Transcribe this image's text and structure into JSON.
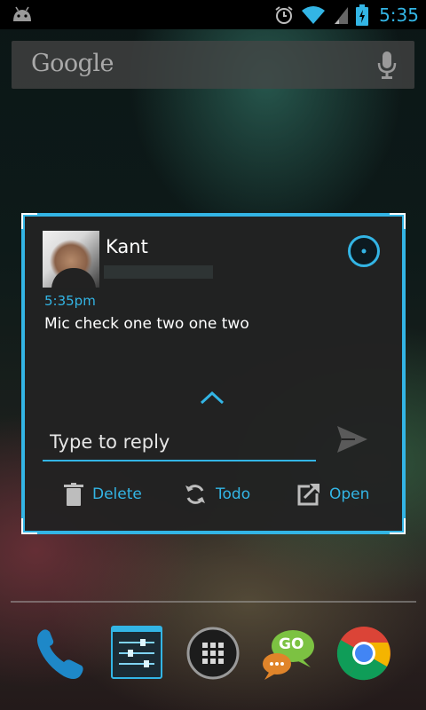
{
  "status_bar": {
    "time": "5:35",
    "icons": [
      "android-debug-icon",
      "alarm-icon",
      "wifi-icon",
      "signal-icon",
      "battery-charging-icon"
    ]
  },
  "search": {
    "logo_text": "Google",
    "icon": "mic-icon"
  },
  "widget": {
    "contact_name": "Kant",
    "message_time": "5:35pm",
    "message_text": "Mic check one two one two",
    "reply_placeholder": "Type to reply",
    "actions": {
      "delete_label": "Delete",
      "todo_label": "Todo",
      "open_label": "Open"
    },
    "accent_color": "#33b5e5"
  },
  "dock": {
    "apps": [
      "phone-app",
      "settings-sliders-app",
      "all-apps",
      "go-sms-app",
      "chrome-app"
    ],
    "go_sms_label": "GO"
  },
  "colors": {
    "accent": "#33b5e5",
    "status_bar_bg": "#000000",
    "widget_bg": "#222222"
  }
}
